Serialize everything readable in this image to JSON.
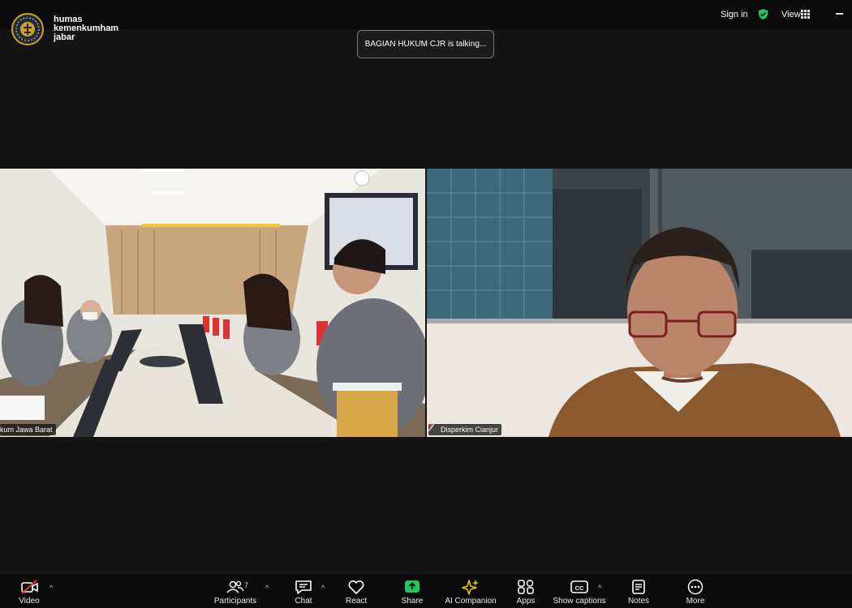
{
  "window": {
    "brand_lines": [
      "humas",
      "kemenkumham",
      "jabar"
    ],
    "sign_in_label": "Sign in",
    "view_label": "View",
    "security_icon": "shield-check-icon",
    "accent_green": "#22c55e"
  },
  "meeting": {
    "talking_notice": "BAGIAN HUKUM CJR is talking..."
  },
  "tiles": [
    {
      "name": "kum Jawa Barat",
      "muted": false
    },
    {
      "name": "Disperkim Cianjur",
      "muted": true
    }
  ],
  "toolbar": {
    "video_label": "Video",
    "participants_label": "Participants",
    "participants_count": "7",
    "chat_label": "Chat",
    "react_label": "React",
    "share_label": "Share",
    "ai_label": "AI Companion",
    "apps_label": "Apps",
    "captions_label": "Show captions",
    "notes_label": "Notes",
    "more_label": "More",
    "video_off_color": "#e53935",
    "share_color": "#22c55e",
    "ai_color": "#f5c518"
  }
}
